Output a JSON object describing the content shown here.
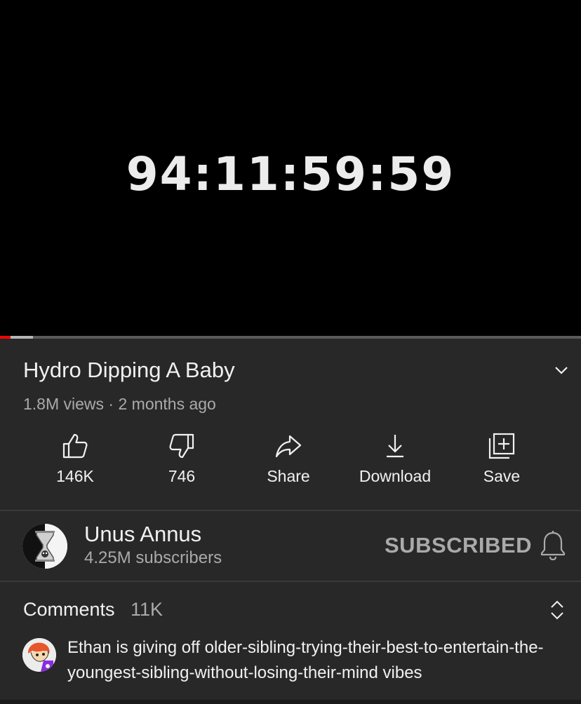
{
  "player": {
    "countdown": "94:11:59:59",
    "progress_played": 0.018,
    "progress_buffered": 0.057
  },
  "video": {
    "title": "Hydro Dipping A Baby",
    "meta": "1.8M views · 2 months ago"
  },
  "actions": {
    "like_count": "146K",
    "dislike_count": "746",
    "share_label": "Share",
    "download_label": "Download",
    "save_label": "Save"
  },
  "channel": {
    "name": "Unus Annus",
    "subscribers": "4.25M subscribers",
    "subscribe_state": "SUBSCRIBED"
  },
  "comments": {
    "heading": "Comments",
    "count": "11K",
    "top_comment": "Ethan is giving off older-sibling-trying-their-best-to-entertain-the-youngest-sibling-without-losing-their-mind vibes"
  },
  "colors": {
    "background": "#282828",
    "player_bg": "#000000",
    "progress_played": "#ff0000",
    "text_primary": "#f1f1f1",
    "text_secondary": "#aaaaaa"
  },
  "icons": [
    "chevron-down-icon",
    "thumbs-up-icon",
    "thumbs-down-icon",
    "share-arrow-icon",
    "download-icon",
    "playlist-add-icon",
    "bell-icon",
    "sort-expand-icon"
  ]
}
